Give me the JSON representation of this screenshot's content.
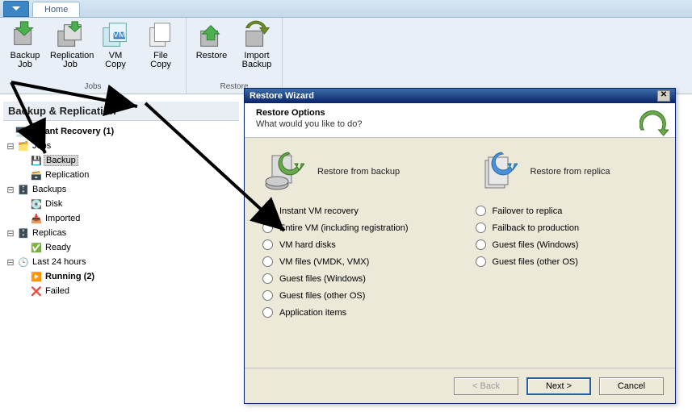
{
  "titlebar": {
    "tab": "Home"
  },
  "ribbon": {
    "groups": [
      {
        "label": "Jobs",
        "buttons": [
          {
            "name": "backup-job-button",
            "l1": "Backup",
            "l2": "Job"
          },
          {
            "name": "replication-job-button",
            "l1": "Replication",
            "l2": "Job"
          },
          {
            "name": "vm-copy-button",
            "l1": "VM",
            "l2": "Copy"
          },
          {
            "name": "file-copy-button",
            "l1": "File",
            "l2": "Copy"
          }
        ]
      },
      {
        "label": "Restore",
        "buttons": [
          {
            "name": "restore-button",
            "l1": "Restore",
            "l2": ""
          },
          {
            "name": "import-backup-button",
            "l1": "Import",
            "l2": "Backup"
          }
        ]
      }
    ]
  },
  "sidebar": {
    "title": "Backup & Replication",
    "nodes": {
      "instant_recovery": "Instant Recovery (1)",
      "jobs": "Jobs",
      "backup": "Backup",
      "replication": "Replication",
      "backups": "Backups",
      "disk": "Disk",
      "imported": "Imported",
      "replicas": "Replicas",
      "ready": "Ready",
      "last24": "Last 24 hours",
      "running": "Running (2)",
      "failed": "Failed"
    }
  },
  "dialog": {
    "title": "Restore Wizard",
    "heading": "Restore Options",
    "subheading": "What would you like to do?",
    "col_backup_title": "Restore from backup",
    "col_replica_title": "Restore from replica",
    "backup_opts": [
      "Instant VM recovery",
      "Entire VM (including registration)",
      "VM hard disks",
      "VM files (VMDK, VMX)",
      "Guest files (Windows)",
      "Guest files (other OS)",
      "Application items"
    ],
    "replica_opts": [
      "Failover to replica",
      "Failback to production",
      "Guest files (Windows)",
      "Guest files (other OS)"
    ],
    "buttons": {
      "back": "< Back",
      "next": "Next >",
      "cancel": "Cancel"
    }
  }
}
